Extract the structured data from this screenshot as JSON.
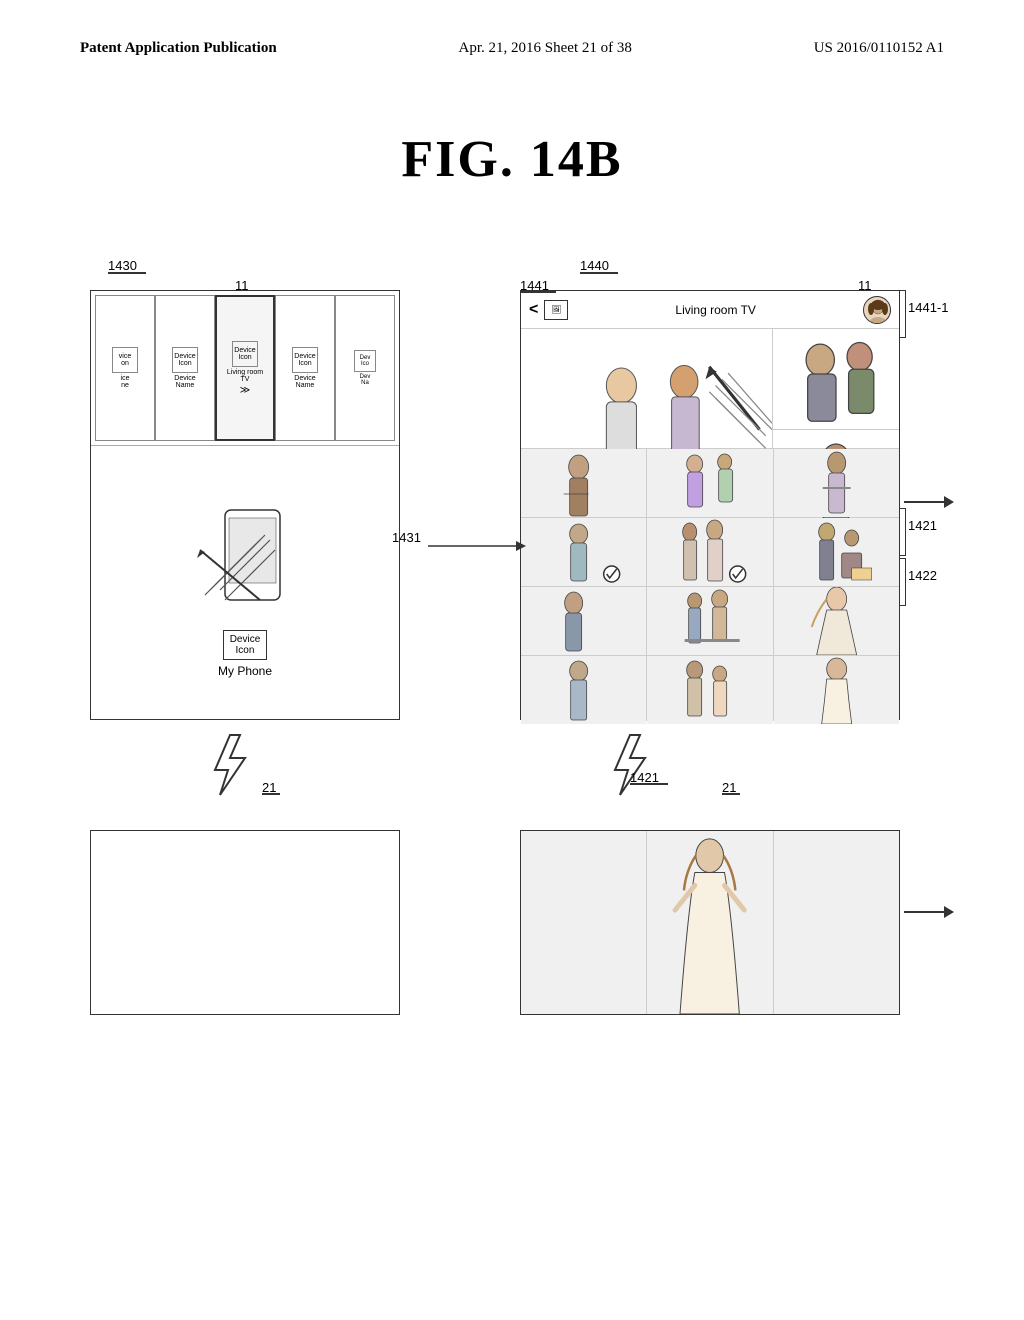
{
  "header": {
    "left": "Patent Application Publication",
    "center": "Apr. 21, 2016  Sheet 21 of 38",
    "right": "US 2016/0110152 A1"
  },
  "figure": {
    "title": "FIG. 14B"
  },
  "labels": {
    "fig1430": "1430",
    "fig1440": "1440",
    "fig1441": "1441",
    "fig1441_1": "1441-1",
    "fig1431": "1431",
    "fig1421_top": "1421",
    "fig1422": "1422",
    "fig1421_bot": "1421",
    "num11_left": "11",
    "num11_right": "11",
    "num21_left": "21",
    "num21_right": "21"
  },
  "deviceGrid": {
    "cells": [
      {
        "icon": "Device\nIcon",
        "name": "Device\nName"
      },
      {
        "icon": "Device\nIcon",
        "name": "Device\nName"
      },
      {
        "icon": "Device\nIcon",
        "name": "Living room\nTV"
      },
      {
        "icon": "Device\nIcon",
        "name": "Device\nName"
      },
      {
        "icon": "Dev\nIco",
        "name": "Dev\nNa"
      }
    ]
  },
  "phoneLabel": "My Phone",
  "phoneIconLabel": "Device\nIcon",
  "tvTitle": "Living room TV",
  "backBtn": "<",
  "arrowLabel": "→"
}
